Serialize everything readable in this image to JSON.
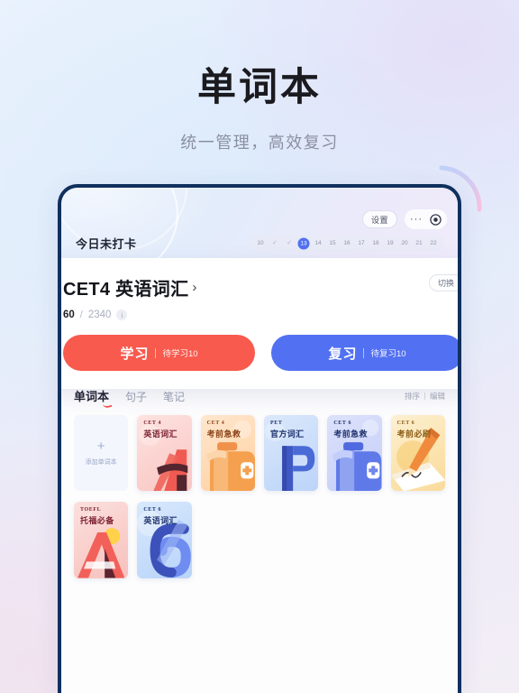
{
  "hero": {
    "title": "单词本",
    "subtitle": "统一管理，高效复习"
  },
  "colors": {
    "accent_red": "#f85a4e",
    "accent_blue": "#5271f2",
    "device_frame": "#10305e",
    "text_primary": "#15161c",
    "text_muted": "#9aa0b0"
  },
  "app": {
    "window_controls": {
      "settings_label": "设置",
      "more_icon": "···",
      "close_icon": "close-target-icon"
    },
    "checkin_text": "今日未打卡",
    "calendar": {
      "cells": [
        {
          "label": "10",
          "type": "day"
        },
        {
          "label": "✓",
          "type": "check"
        },
        {
          "label": "✓",
          "type": "check"
        },
        {
          "label": "13",
          "type": "active"
        },
        {
          "label": "14",
          "type": "day"
        },
        {
          "label": "15",
          "type": "day"
        },
        {
          "label": "16",
          "type": "day"
        },
        {
          "label": "17",
          "type": "day"
        },
        {
          "label": "18",
          "type": "day"
        },
        {
          "label": "19",
          "type": "day"
        },
        {
          "label": "20",
          "type": "day"
        },
        {
          "label": "21",
          "type": "day"
        },
        {
          "label": "22",
          "type": "day"
        }
      ]
    },
    "main_card": {
      "book_title": "CET4 英语词汇",
      "chevron": "›",
      "switch_label": "切换",
      "progress_current": "60",
      "progress_slash": "/",
      "progress_total": "2340",
      "info_icon": "i",
      "study_button": {
        "label": "学习",
        "sub": "待学习10"
      },
      "review_button": {
        "label": "复习",
        "sub": "待复习10"
      }
    },
    "list_section": {
      "tabs": [
        {
          "label": "单词本",
          "active": true
        },
        {
          "label": "句子",
          "active": false
        },
        {
          "label": "笔记",
          "active": false
        }
      ],
      "tools": [
        {
          "label": "排序"
        },
        {
          "label": "编辑"
        }
      ],
      "add_card": {
        "plus": "+",
        "label": "添加单词本"
      },
      "books": [
        {
          "sub": "CET 4",
          "name": "英语词汇",
          "cover": "cv-pink",
          "text": "t-dark-red",
          "art": "letter-a-pink"
        },
        {
          "sub": "CET 4",
          "name": "考前急救",
          "cover": "cv-orange",
          "text": "t-dark-org",
          "art": "firstaid-orange"
        },
        {
          "sub": "PET",
          "name": "官方词汇",
          "cover": "cv-blue",
          "text": "t-dark-blue",
          "art": "letter-p-blue"
        },
        {
          "sub": "CET 6",
          "name": "考前急救",
          "cover": "cv-periw",
          "text": "t-dark-blue",
          "art": "firstaid-blue"
        },
        {
          "sub": "CET 6",
          "name": "考前必刷",
          "cover": "cv-cream",
          "text": "t-dark-amb",
          "art": "pencil-paper"
        },
        {
          "sub": "TOEFL",
          "name": "托福必备",
          "cover": "cv-rose",
          "text": "t-dark-red",
          "art": "letter-a-red"
        },
        {
          "sub": "CET 6",
          "name": "英语词汇",
          "cover": "cv-sky",
          "text": "t-dark-blue",
          "art": "digit-six-blue"
        }
      ]
    }
  }
}
